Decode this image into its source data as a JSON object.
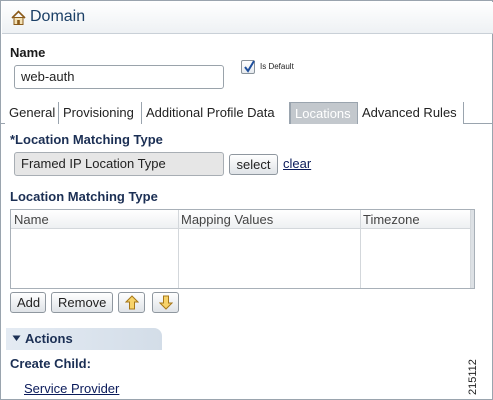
{
  "header": {
    "title": "Domain",
    "icon": "home-icon"
  },
  "form": {
    "name_label": "Name",
    "name_value": "web-auth",
    "is_default_label": "Is Default",
    "is_default_checked": true
  },
  "tabs": [
    {
      "label": "General",
      "active": false
    },
    {
      "label": "Provisioning",
      "active": false
    },
    {
      "label": "Additional Profile Data",
      "active": false
    },
    {
      "label": "Locations",
      "active": true
    },
    {
      "label": "Advanced Rules",
      "active": false
    }
  ],
  "locations": {
    "matching_type_label": "*Location Matching Type",
    "matching_type_value": "Framed IP Location Type",
    "select_label": "select",
    "clear_label": "clear",
    "list_label": "Location Matching Type",
    "columns": [
      "Name",
      "Mapping Values",
      "Timezone"
    ],
    "rows": [],
    "add_label": "Add",
    "remove_label": "Remove",
    "move_up_icon": "arrow-up-icon",
    "move_down_icon": "arrow-down-icon"
  },
  "actions": {
    "title": "Actions",
    "create_child_label": "Create Child:",
    "links": [
      "Service Provider"
    ]
  },
  "figure_number": "215112",
  "colors": {
    "title": "#1b3f66",
    "section_label": "#1b2f54",
    "link": "#0a1a5a",
    "active_tab_bg": "#c3c8cd"
  }
}
